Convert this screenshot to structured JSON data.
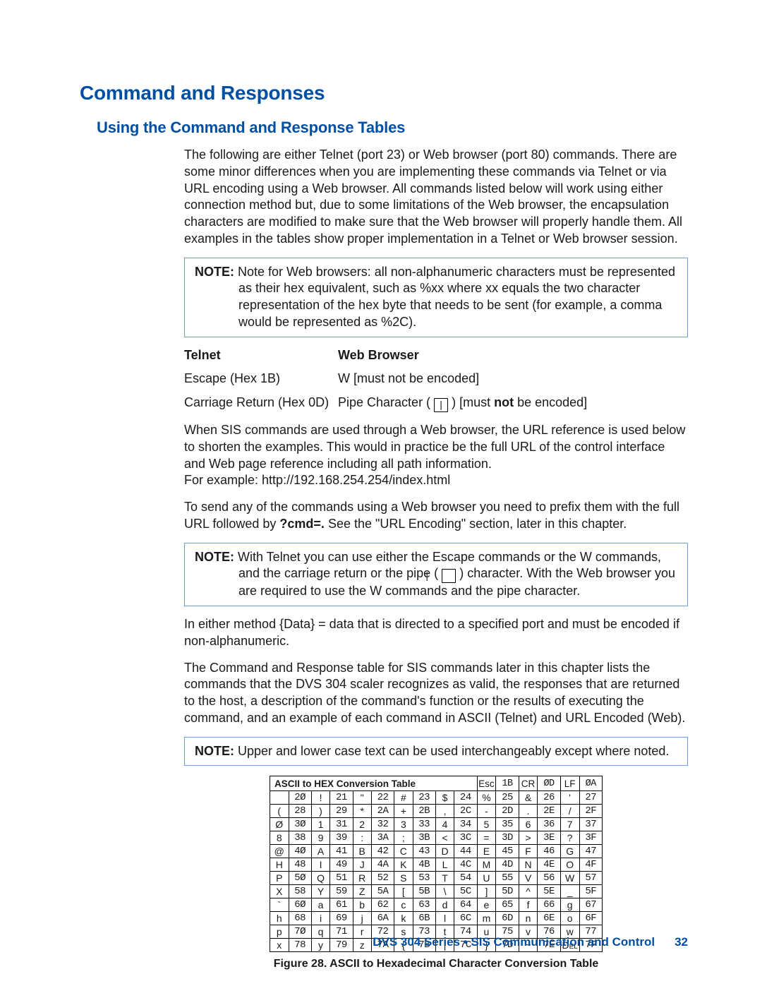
{
  "headings": {
    "h1": "Command and Responses",
    "h2": "Using the Command and Response Tables"
  },
  "paragraphs": {
    "intro": "The following are either Telnet (port 23) or Web browser (port 80) commands. There are some minor differences when you are implementing these commands via Telnet or via URL encoding using a Web browser. All commands listed below will work using either connection method but, due to some limitations of the Web browser, the encapsulation characters are modified to make sure that the Web browser will properly handle them. All examples in the tables show proper implementation in a Telnet or Web browser session.",
    "note1_label": "NOTE:",
    "note1_body": " Note for Web browsers: all non-alphanumeric characters must be represented as their hex equivalent, such as %xx where xx equals the two character representation of the hex byte that needs to be sent (for example, a comma would be represented as %2C).",
    "telnet_head": "Telnet",
    "web_head": "Web Browser",
    "telnet_row1": "Escape (Hex 1B)",
    "web_row1": "W [must not be encoded]",
    "telnet_row2": "Carriage Return (Hex 0D)",
    "web_row2a": "Pipe Character (",
    "web_row2_pipe": "|",
    "web_row2b": ") [must ",
    "web_row2_bold": "not",
    "web_row2c": " be encoded]",
    "p_sis": "When SIS commands are used through a Web browser, the URL reference is used below to shorten the examples. This would in practice be the full URL of the control interface and Web page reference including all path information.",
    "p_example": "For example: http://192.168.254.254/index.html",
    "p_prefix_a": "To send any of the commands using a Web browser you need to prefix them with the full URL followed by ",
    "p_prefix_bold": "?cmd=.",
    "p_prefix_b": " See the \"URL Encoding\" section, later in this chapter.",
    "note2_label": "NOTE:",
    "note2_a": " With Telnet you can use either the Escape commands or the W commands, and the carriage return or the pipe (",
    "note2_pipe": "|",
    "note2_b": ") character. With the Web browser you are required to use the W commands and the pipe character.",
    "p_either": "In either method {Data} = data that is directed to a specified port and must be encoded if non-alphanumeric.",
    "p_table_desc": "The Command and Response table for SIS commands later in this chapter lists the commands that the DVS 304 scaler recognizes as valid, the responses that are returned to the host, a description of the command's function or the results of executing the command, and an example of each command in ASCII (Telnet) and URL Encoded (Web).",
    "note3_label": "NOTE:",
    "note3_body": " Upper and lower case text can be used interchangeably except where noted."
  },
  "ascii": {
    "title": "ASCII to HEX  Conversion Table",
    "extras": [
      {
        "ch": "Esc",
        "hx": "1B"
      },
      {
        "ch": "CR",
        "hx": "ØD"
      },
      {
        "ch": "LF",
        "hx": "ØA"
      }
    ],
    "rows": [
      [
        [
          " ",
          "2Ø"
        ],
        [
          "!",
          "21"
        ],
        [
          "\"",
          "22"
        ],
        [
          "#",
          "23"
        ],
        [
          "$",
          "24"
        ],
        [
          "%",
          "25"
        ],
        [
          "&",
          "26"
        ],
        [
          "'",
          "27"
        ]
      ],
      [
        [
          "(",
          "28"
        ],
        [
          ")",
          "29"
        ],
        [
          "*",
          "2A"
        ],
        [
          "+",
          "2B"
        ],
        [
          ",",
          "2C"
        ],
        [
          "-",
          "2D"
        ],
        [
          ".",
          "2E"
        ],
        [
          "/",
          "2F"
        ]
      ],
      [
        [
          "Ø",
          "3Ø"
        ],
        [
          "1",
          "31"
        ],
        [
          "2",
          "32"
        ],
        [
          "3",
          "33"
        ],
        [
          "4",
          "34"
        ],
        [
          "5",
          "35"
        ],
        [
          "6",
          "36"
        ],
        [
          "7",
          "37"
        ]
      ],
      [
        [
          "8",
          "38"
        ],
        [
          "9",
          "39"
        ],
        [
          ":",
          "3A"
        ],
        [
          ";",
          "3B"
        ],
        [
          "<",
          "3C"
        ],
        [
          "=",
          "3D"
        ],
        [
          ">",
          "3E"
        ],
        [
          "?",
          "3F"
        ]
      ],
      [
        [
          "@",
          "4Ø"
        ],
        [
          "A",
          "41"
        ],
        [
          "B",
          "42"
        ],
        [
          "C",
          "43"
        ],
        [
          "D",
          "44"
        ],
        [
          "E",
          "45"
        ],
        [
          "F",
          "46"
        ],
        [
          "G",
          "47"
        ]
      ],
      [
        [
          "H",
          "48"
        ],
        [
          "I",
          "49"
        ],
        [
          "J",
          "4A"
        ],
        [
          "K",
          "4B"
        ],
        [
          "L",
          "4C"
        ],
        [
          "M",
          "4D"
        ],
        [
          "N",
          "4E"
        ],
        [
          "O",
          "4F"
        ]
      ],
      [
        [
          "P",
          "5Ø"
        ],
        [
          "Q",
          "51"
        ],
        [
          "R",
          "52"
        ],
        [
          "S",
          "53"
        ],
        [
          "T",
          "54"
        ],
        [
          "U",
          "55"
        ],
        [
          "V",
          "56"
        ],
        [
          "W",
          "57"
        ]
      ],
      [
        [
          "X",
          "58"
        ],
        [
          "Y",
          "59"
        ],
        [
          "Z",
          "5A"
        ],
        [
          "[",
          "5B"
        ],
        [
          "\\",
          "5C"
        ],
        [
          "]",
          "5D"
        ],
        [
          "^",
          "5E"
        ],
        [
          "_",
          "5F"
        ]
      ],
      [
        [
          "`",
          "6Ø"
        ],
        [
          "a",
          "61"
        ],
        [
          "b",
          "62"
        ],
        [
          "c",
          "63"
        ],
        [
          "d",
          "64"
        ],
        [
          "e",
          "65"
        ],
        [
          "f",
          "66"
        ],
        [
          "g",
          "67"
        ]
      ],
      [
        [
          "h",
          "68"
        ],
        [
          "i",
          "69"
        ],
        [
          "j",
          "6A"
        ],
        [
          "k",
          "6B"
        ],
        [
          "l",
          "6C"
        ],
        [
          "m",
          "6D"
        ],
        [
          "n",
          "6E"
        ],
        [
          "o",
          "6F"
        ]
      ],
      [
        [
          "p",
          "7Ø"
        ],
        [
          "q",
          "71"
        ],
        [
          "r",
          "72"
        ],
        [
          "s",
          "73"
        ],
        [
          "t",
          "74"
        ],
        [
          "u",
          "75"
        ],
        [
          "v",
          "76"
        ],
        [
          "w",
          "77"
        ]
      ],
      [
        [
          "x",
          "78"
        ],
        [
          "y",
          "79"
        ],
        [
          "z",
          "7A"
        ],
        [
          "{",
          "7B"
        ],
        [
          "|",
          "7C"
        ],
        [
          "}",
          "7D"
        ],
        [
          "~",
          "7E"
        ],
        [
          "Del",
          "7F"
        ]
      ]
    ],
    "figcap_label": "Figure 28.",
    "figcap_rest": " ASCII to Hexadecimal Character Conversion Table"
  },
  "footer": {
    "text": "DVS 304 Series • SIS Communication and Control",
    "page": "32"
  }
}
